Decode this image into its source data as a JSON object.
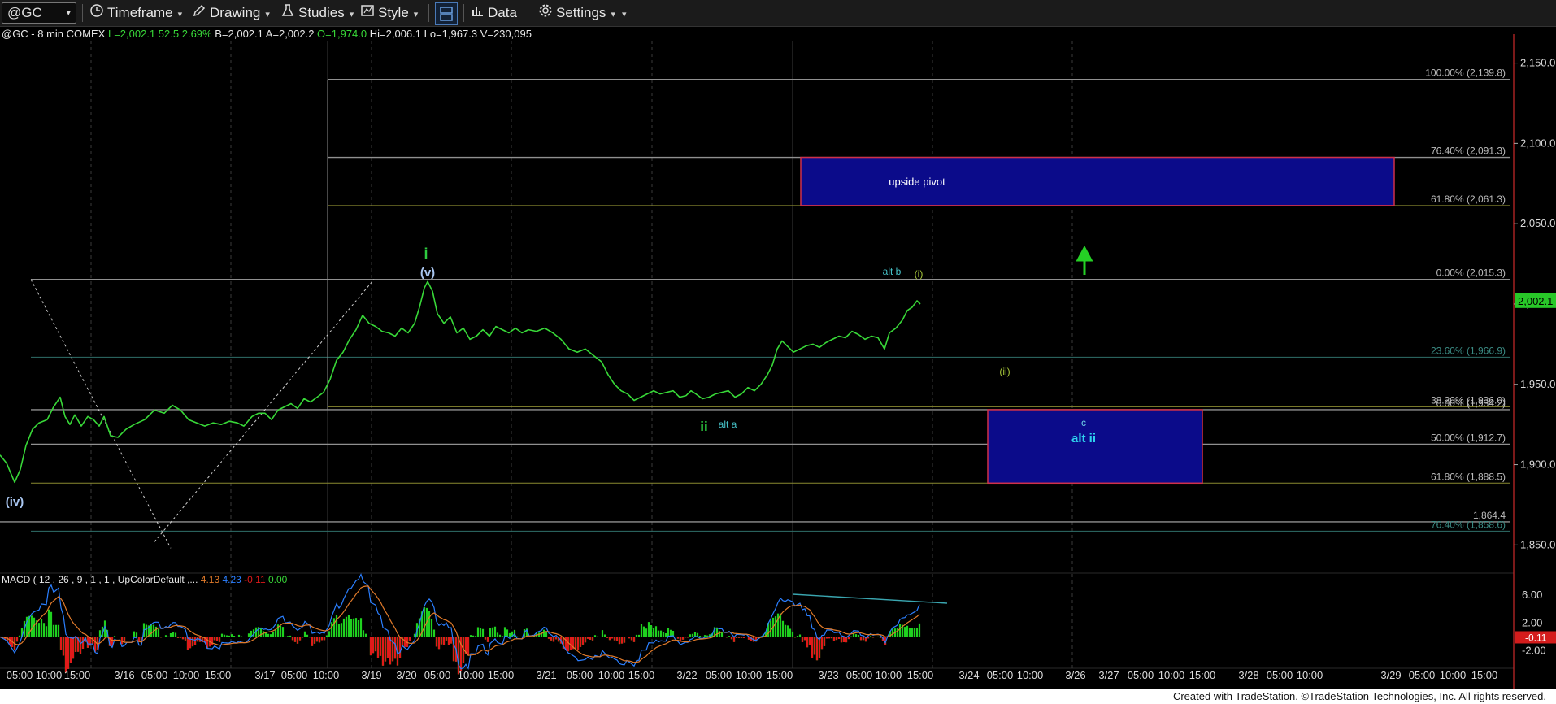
{
  "toolbar": {
    "symbol": "@GC",
    "timeframe": "Timeframe",
    "drawing": "Drawing",
    "studies": "Studies",
    "style": "Style",
    "data": "Data",
    "settings": "Settings"
  },
  "info": {
    "prefix": "@GC - 8 min",
    "exchange": "COMEX",
    "last": "L=2,002.1",
    "change": "52.5",
    "pct": "2.69%",
    "bid": "B=2,002.1",
    "ask": "A=2,002.2",
    "open": "O=1,974.0",
    "high": "Hi=2,006.1",
    "low": "Lo=1,967.3",
    "volume": "V=230,095"
  },
  "colors": {
    "price": "#38d838",
    "fib_gold": "#8a8a30",
    "fib_gray": "#909090",
    "fib_teal": "#2f6f6a",
    "box_fill": "#0b0b8a",
    "box_border": "#d0304a",
    "macd_up": "#1fd11f",
    "macd_down": "#e01a1a",
    "macd_line": "#2b7fff",
    "signal_line": "#e07a2a"
  },
  "chart_data": {
    "type": "line",
    "title": "@GC - 8 min COMEX",
    "price_axis": {
      "range": [
        1835,
        2168
      ],
      "ticks": [
        1850,
        1900,
        1950,
        2000,
        2050,
        2100,
        2150
      ],
      "tick_labels": [
        "1,850.0",
        "1,900.0",
        "1,950.0",
        "2,000.0",
        "2,050.0",
        "2,100.0",
        "2,150.0"
      ],
      "last_label": "2,002.1"
    },
    "x_axis": {
      "labels": [
        "05:00",
        "10:00",
        "15:00",
        "3/16",
        "05:00",
        "10:00",
        "15:00",
        "3/17",
        "05:00",
        "10:00",
        "3/19",
        "3/20",
        "05:00",
        "10:00",
        "15:00",
        "3/21",
        "05:00",
        "10:00",
        "15:00",
        "3/22",
        "05:00",
        "10:00",
        "15:00",
        "3/23",
        "05:00",
        "10:00",
        "15:00",
        "3/24",
        "05:00",
        "10:00",
        "3/26",
        "3/27",
        "05:00",
        "10:00",
        "15:00",
        "3/28",
        "05:00",
        "10:00",
        "3/29",
        "05:00",
        "10:00",
        "15:00"
      ]
    },
    "price_series": {
      "name": "@GC",
      "points": [
        [
          0,
          1906
        ],
        [
          8,
          1901
        ],
        [
          18,
          1889
        ],
        [
          25,
          1897
        ],
        [
          32,
          1912
        ],
        [
          40,
          1922
        ],
        [
          48,
          1926
        ],
        [
          58,
          1928
        ],
        [
          66,
          1936
        ],
        [
          74,
          1942
        ],
        [
          80,
          1930
        ],
        [
          86,
          1925
        ],
        [
          92,
          1931
        ],
        [
          100,
          1924
        ],
        [
          108,
          1930
        ],
        [
          115,
          1928
        ],
        [
          122,
          1924
        ],
        [
          128,
          1930
        ],
        [
          136,
          1918
        ],
        [
          145,
          1917
        ],
        [
          155,
          1922
        ],
        [
          165,
          1925
        ],
        [
          178,
          1928
        ],
        [
          190,
          1934
        ],
        [
          202,
          1932
        ],
        [
          212,
          1937
        ],
        [
          222,
          1934
        ],
        [
          232,
          1928
        ],
        [
          242,
          1926
        ],
        [
          252,
          1924
        ],
        [
          262,
          1926
        ],
        [
          272,
          1925
        ],
        [
          282,
          1927
        ],
        [
          292,
          1926
        ],
        [
          300,
          1924
        ],
        [
          310,
          1930
        ],
        [
          318,
          1932
        ],
        [
          326,
          1932
        ],
        [
          334,
          1928
        ],
        [
          342,
          1934
        ],
        [
          350,
          1936
        ],
        [
          358,
          1938
        ],
        [
          366,
          1935
        ],
        [
          374,
          1941
        ],
        [
          382,
          1939
        ],
        [
          390,
          1942
        ],
        [
          398,
          1945
        ],
        [
          406,
          1953
        ],
        [
          414,
          1965
        ],
        [
          422,
          1970
        ],
        [
          430,
          1978
        ],
        [
          438,
          1984
        ],
        [
          446,
          1993
        ],
        [
          454,
          1988
        ],
        [
          462,
          1986
        ],
        [
          470,
          1983
        ],
        [
          478,
          1982
        ],
        [
          486,
          1980
        ],
        [
          494,
          1985
        ],
        [
          502,
          1982
        ],
        [
          510,
          1988
        ],
        [
          516,
          1998
        ],
        [
          522,
          2010
        ],
        [
          526,
          2014
        ],
        [
          532,
          2008
        ],
        [
          538,
          1994
        ],
        [
          546,
          1988
        ],
        [
          554,
          1992
        ],
        [
          562,
          1982
        ],
        [
          570,
          1985
        ],
        [
          578,
          1978
        ],
        [
          586,
          1980
        ],
        [
          594,
          1984
        ],
        [
          602,
          1980
        ],
        [
          610,
          1986
        ],
        [
          618,
          1984
        ],
        [
          626,
          1982
        ],
        [
          634,
          1985
        ],
        [
          642,
          1982
        ],
        [
          650,
          1984
        ],
        [
          660,
          1983
        ],
        [
          670,
          1985
        ],
        [
          680,
          1982
        ],
        [
          690,
          1978
        ],
        [
          700,
          1972
        ],
        [
          710,
          1970
        ],
        [
          720,
          1972
        ],
        [
          730,
          1968
        ],
        [
          740,
          1964
        ],
        [
          748,
          1956
        ],
        [
          756,
          1950
        ],
        [
          764,
          1946
        ],
        [
          772,
          1944
        ],
        [
          780,
          1940
        ],
        [
          788,
          1942
        ],
        [
          796,
          1944
        ],
        [
          804,
          1946
        ],
        [
          812,
          1944
        ],
        [
          820,
          1945
        ],
        [
          828,
          1946
        ],
        [
          836,
          1942
        ],
        [
          844,
          1943
        ],
        [
          850,
          1946
        ],
        [
          856,
          1944
        ],
        [
          864,
          1941
        ],
        [
          872,
          1942
        ],
        [
          880,
          1944
        ],
        [
          888,
          1945
        ],
        [
          896,
          1946
        ],
        [
          904,
          1942
        ],
        [
          912,
          1944
        ],
        [
          920,
          1948
        ],
        [
          928,
          1946
        ],
        [
          936,
          1950
        ],
        [
          944,
          1956
        ],
        [
          950,
          1962
        ],
        [
          956,
          1972
        ],
        [
          962,
          1977
        ],
        [
          968,
          1974
        ],
        [
          976,
          1970
        ],
        [
          984,
          1972
        ],
        [
          992,
          1974
        ],
        [
          1000,
          1975
        ],
        [
          1008,
          1973
        ],
        [
          1016,
          1976
        ],
        [
          1024,
          1978
        ],
        [
          1032,
          1980
        ],
        [
          1040,
          1979
        ],
        [
          1048,
          1983
        ],
        [
          1056,
          1981
        ],
        [
          1064,
          1978
        ],
        [
          1072,
          1980
        ],
        [
          1080,
          1979
        ],
        [
          1088,
          1972
        ],
        [
          1094,
          1982
        ],
        [
          1102,
          1985
        ],
        [
          1110,
          1990
        ],
        [
          1116,
          1996
        ],
        [
          1122,
          1998
        ],
        [
          1128,
          2002
        ],
        [
          1132,
          2000
        ]
      ]
    },
    "fib_levels": [
      {
        "label": "100.00% (2,139.8)",
        "value": 2139.8,
        "color": "gray"
      },
      {
        "label": "76.40% (2,091.3)",
        "value": 2091.3,
        "color": "gray"
      },
      {
        "label": "61.80% (2,061.3)",
        "value": 2061.3,
        "color": "gold"
      },
      {
        "label": "0.00% (2,015.3)",
        "value": 2015.3,
        "color": "gray"
      },
      {
        "label": "23.60% (1,966.9)",
        "value": 1966.9,
        "color": "teal"
      },
      {
        "label": "38.20% (1,936.0)",
        "value": 1936.0,
        "color": "gold"
      },
      {
        "label": "0.00% (1,934.2)",
        "value": 1934.2,
        "color": "gray"
      },
      {
        "label": "50.00% (1,912.7)",
        "value": 1912.7,
        "color": "gray"
      },
      {
        "label": "61.80% (1,888.5)",
        "value": 1888.5,
        "color": "gold"
      },
      {
        "label": "1,864.4",
        "value": 1864.4,
        "color": "gray"
      },
      {
        "label": "76.40% (1,858.6)",
        "value": 1858.6,
        "color": "teal"
      }
    ],
    "boxes": [
      {
        "label": "upside pivot",
        "top": 2091.3,
        "bottom": 2061.3
      },
      {
        "label": "alt ii",
        "sublabel": "c",
        "top": 1934.2,
        "bottom": 1888.5
      }
    ],
    "wave_labels": [
      {
        "text": "(iv)",
        "color": "lightblue"
      },
      {
        "text": "i",
        "color": "green"
      },
      {
        "text": "(v)",
        "color": "lightblue"
      },
      {
        "text": "ii",
        "color": "green"
      },
      {
        "text": "alt a",
        "color": "teal"
      },
      {
        "text": "alt b",
        "color": "teal"
      },
      {
        "text": "(i)",
        "color": "olive"
      },
      {
        "text": "(ii)",
        "color": "olive"
      }
    ],
    "macd": {
      "label": "MACD ( 12 , 26 , 9 , 1 , 1 , UpColorDefault ,...",
      "values": [
        "4.13",
        "4.23",
        "-0.11",
        "0.00"
      ],
      "value_colors": [
        "#e07a2a",
        "#2b7fff",
        "#e01a1a",
        "#38d838"
      ],
      "range": [
        -4.5,
        8
      ],
      "ticks": [
        6,
        2,
        -2
      ],
      "tick_labels": [
        "6.00",
        "2.00",
        "-2.00"
      ],
      "last_label": "-0.11"
    }
  },
  "footer": "Created with TradeStation. ©TradeStation Technologies, Inc. All rights reserved."
}
